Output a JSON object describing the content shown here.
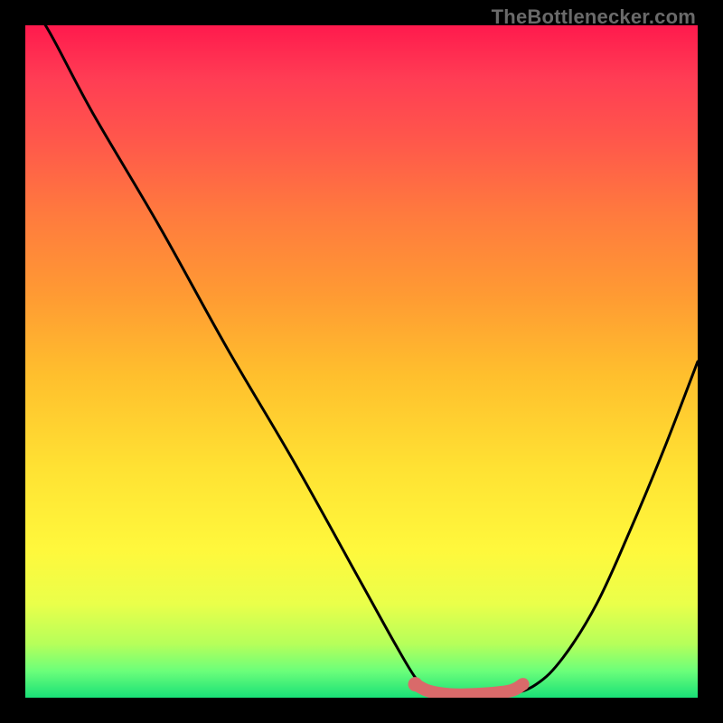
{
  "credit_text": "TheBottlenecker.com",
  "colors": {
    "page_bg": "#000000",
    "curve": "#000000",
    "highlight": "#d96a6a",
    "gradient_top": "#ff1a4d",
    "gradient_bottom": "#19e077"
  },
  "chart_data": {
    "type": "line",
    "title": "",
    "xlabel": "",
    "ylabel": "",
    "xlim": [
      0,
      100
    ],
    "ylim": [
      0,
      100
    ],
    "x": [
      0,
      3,
      10,
      20,
      30,
      40,
      50,
      55,
      58,
      60,
      63,
      67,
      72,
      76,
      80,
      85,
      90,
      95,
      100
    ],
    "values": [
      103,
      100,
      87,
      70,
      52,
      35,
      17,
      8,
      3,
      1,
      0,
      0,
      0.5,
      2,
      6,
      14,
      25,
      37,
      50
    ],
    "highlight_segment": {
      "x": [
        58,
        60,
        63,
        67,
        72,
        74
      ],
      "values": [
        2,
        1,
        0.5,
        0.5,
        1,
        2
      ]
    },
    "highlight_marker": {
      "x": 58,
      "y": 2
    }
  }
}
